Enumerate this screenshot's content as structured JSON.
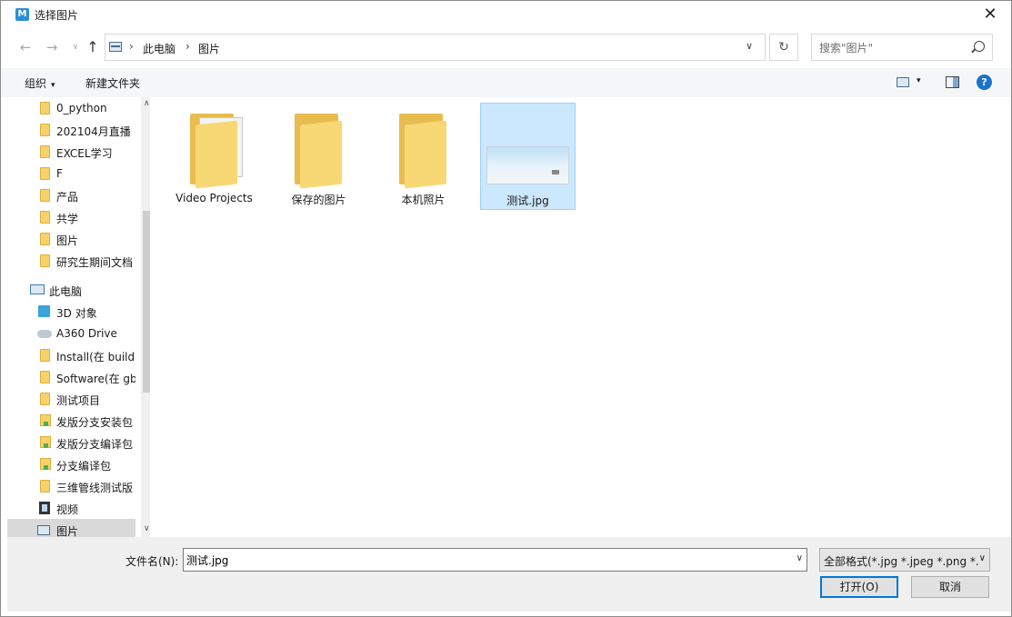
{
  "window": {
    "title": "选择图片",
    "app_icon_letter": "M",
    "close_glyph": "✕"
  },
  "nav": {
    "back_glyph": "←",
    "forward_glyph": "→",
    "recent_glyph": "∨",
    "up_glyph": "↑",
    "breadcrumb": [
      "此电脑",
      "图片"
    ],
    "crumb_sep": "›",
    "dropdown_glyph": "∨",
    "refresh_glyph": "↻",
    "search_placeholder": "搜索\"图片\""
  },
  "toolbar": {
    "organize_label": "组织",
    "organize_caret": "▾",
    "new_folder_label": "新建文件夹",
    "view_caret": "▾",
    "help_glyph": "?"
  },
  "sidebar": {
    "items": [
      {
        "label": "0_python",
        "icon": "folder-icon"
      },
      {
        "label": "202104月直播",
        "icon": "folder-icon"
      },
      {
        "label": "EXCEL学习",
        "icon": "folder-icon"
      },
      {
        "label": "F",
        "icon": "folder-icon"
      },
      {
        "label": "产品",
        "icon": "folder-icon"
      },
      {
        "label": "共学",
        "icon": "folder-icon"
      },
      {
        "label": "图片",
        "icon": "folder-icon"
      },
      {
        "label": "研究生期间文档",
        "icon": "folder-icon"
      },
      {
        "label": "此电脑",
        "icon": "computer-icon"
      },
      {
        "label": "3D 对象",
        "icon": "cube-icon"
      },
      {
        "label": "A360 Drive",
        "icon": "cloud-drive-icon"
      },
      {
        "label": "Install(在 buildc",
        "icon": "network-folder-icon"
      },
      {
        "label": "Software(在 gb",
        "icon": "network-folder-icon"
      },
      {
        "label": "测试项目",
        "icon": "folder-icon"
      },
      {
        "label": "发版分支安装包",
        "icon": "network-folder-icon"
      },
      {
        "label": "发版分支编译包",
        "icon": "network-folder-icon"
      },
      {
        "label": "分支编译包",
        "icon": "network-folder-icon"
      },
      {
        "label": "三维管线测试版",
        "icon": "folder-icon"
      },
      {
        "label": "视频",
        "icon": "video-icon"
      },
      {
        "label": "图片",
        "icon": "pictures-icon",
        "selected": true
      }
    ],
    "scroll_up_glyph": "∧",
    "scroll_down_glyph": "∨"
  },
  "content": {
    "tiles": [
      {
        "label": "Video Projects",
        "kind": "folder-with-doc"
      },
      {
        "label": "保存的图片",
        "kind": "folder"
      },
      {
        "label": "本机照片",
        "kind": "folder"
      },
      {
        "label": "测试.jpg",
        "kind": "image",
        "selected": true
      }
    ]
  },
  "bottom": {
    "filename_label": "文件名(N):",
    "filename_value": "测试.jpg",
    "filename_caret": "∨",
    "filter_value": "全部格式(*.jpg *.jpeg *.png *.",
    "filter_caret": "∨",
    "open_label": "打开(O)",
    "cancel_label": "取消"
  },
  "colors": {
    "selected_tile_bg": "#cce8ff",
    "selected_tile_border": "#99d1ff",
    "primary_button_border": "#0078d7",
    "folder_yellow": "#f8d775"
  }
}
